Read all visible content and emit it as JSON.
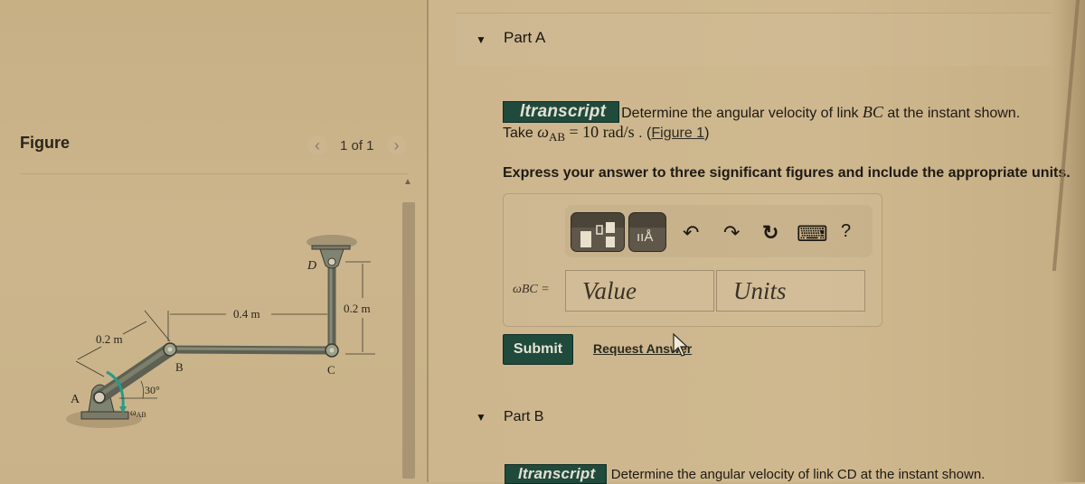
{
  "figure": {
    "title": "Figure",
    "pager": {
      "prev_icon": "chevron-left-icon",
      "current": "1 of 1",
      "next_icon": "chevron-right-icon",
      "prev_glyph": "‹",
      "next_glyph": "›"
    },
    "scroll_up_glyph": "▲",
    "diagram": {
      "labels": {
        "A": "A",
        "B": "B",
        "C": "C",
        "D": "D",
        "dim_ab": "0.2 m",
        "dim_bc": "0.4 m",
        "dim_cd": "0.2 m",
        "angle": "30°",
        "omega": "ω",
        "omega_sub": "AB"
      }
    }
  },
  "partA": {
    "triangle": "▼",
    "label": "Part A",
    "transcript_badge": "ltranscript",
    "question_text": "Determine the angular velocity of link ",
    "question_var": "BC",
    "question_tail": " at the instant shown.",
    "take_text": "Take ",
    "omega": "ω",
    "omega_sub": "AB",
    "equals_value": " = 10 ",
    "unit": "rad/s",
    "period": " . (",
    "figure_link": "Figure 1",
    "close_paren": ")",
    "instruction": "Express your answer to three significant figures and include the appropriate units.",
    "toolbar": {
      "templates_icon": "templates-icon",
      "units_icon": "units-icon",
      "units_glyph": "ııÅ",
      "undo_glyph": "↶",
      "redo_glyph": "↷",
      "reset_glyph": "↻",
      "keyboard_glyph": "⌨",
      "help_glyph": "?"
    },
    "answer_label": "ωBC =",
    "value_placeholder": "Value",
    "units_placeholder": "Units",
    "submit_label": "Submit",
    "request_answer_label": "Request Answer"
  },
  "partB": {
    "triangle": "▼",
    "label": "Part B",
    "transcript_badge": "ltranscript",
    "question_text": "Determine the angular velocity of link CD at the instant shown."
  },
  "colors": {
    "accent_green": "#1f4a3c",
    "background": "#c8b188"
  }
}
